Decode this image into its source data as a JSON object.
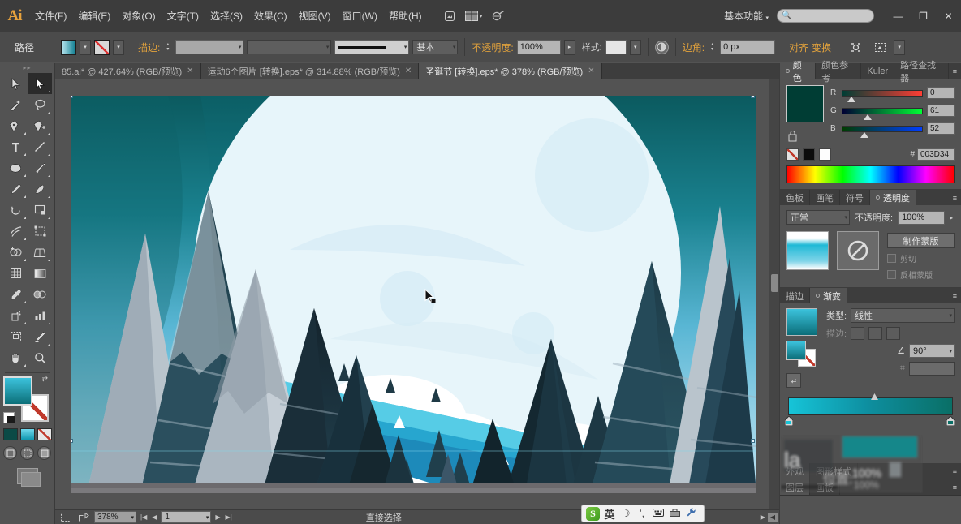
{
  "app": {
    "name": "Adobe Illustrator",
    "logo_text": "Ai"
  },
  "menubar": {
    "items": [
      {
        "label": "文件(F)"
      },
      {
        "label": "编辑(E)"
      },
      {
        "label": "对象(O)"
      },
      {
        "label": "文字(T)"
      },
      {
        "label": "选择(S)"
      },
      {
        "label": "效果(C)"
      },
      {
        "label": "视图(V)"
      },
      {
        "label": "窗口(W)"
      },
      {
        "label": "帮助(H)"
      }
    ],
    "bridge_icon": "bridge-icon",
    "arrange_icon": "arrange-documents-icon",
    "arrange_caret": "▾",
    "stock_icon": "stock-icon",
    "workspace": "基本功能",
    "workspace_caret": "▾",
    "search_placeholder": "",
    "search_value": "",
    "search_icon": "search-icon",
    "window_minimize": "—",
    "window_restore": "❐",
    "window_close": "✕"
  },
  "controlbar": {
    "object_label": "路径",
    "fill_label": "fill-swatch",
    "stroke_label": "stroke-swatch",
    "stroke_weight_label": "描边:",
    "stroke_weight_value": "",
    "stroke_profile_value": "",
    "brush_label": "brush-definition",
    "brush_value": "",
    "stroke_style_value": "",
    "variable_width_label": "基本",
    "opacity_label": "不透明度:",
    "opacity_value": "100%",
    "style_label": "样式:",
    "style_value": "",
    "recolor_icon": "recolor-artwork-icon",
    "corner_label": "边角:",
    "corner_value": "0 px",
    "align_label": "对齐",
    "transform_label": "变换",
    "isolate_icon": "isolate-selected-icon",
    "mask_icon": "edit-clipping-mask-icon",
    "more_caret": "▾"
  },
  "tabs": [
    {
      "label": "85.ai* @ 427.64% (RGB/预览)",
      "close": "✕",
      "active": false
    },
    {
      "label": "运动6个图片 [转换].eps* @ 314.88% (RGB/预览)",
      "close": "✕",
      "active": false
    },
    {
      "label": "圣诞节 [转换].eps* @ 378% (RGB/预览)",
      "close": "✕",
      "active": true
    }
  ],
  "toolbar": {
    "grip": "▸▸",
    "tools": [
      {
        "name": "selection-tool",
        "icon": "arrow-solid"
      },
      {
        "name": "direct-selection-tool",
        "icon": "arrow-hollow",
        "active": true
      },
      {
        "name": "magic-wand-tool",
        "icon": "wand"
      },
      {
        "name": "lasso-tool",
        "icon": "lasso"
      },
      {
        "name": "pen-tool",
        "icon": "pen"
      },
      {
        "name": "add-anchor-point-tool",
        "icon": "pen-plus"
      },
      {
        "name": "type-tool",
        "icon": "type-T"
      },
      {
        "name": "line-segment-tool",
        "icon": "line"
      },
      {
        "name": "ellipse-tool",
        "icon": "ellipse"
      },
      {
        "name": "paintbrush-tool",
        "icon": "paintbrush"
      },
      {
        "name": "pencil-tool",
        "icon": "pencil"
      },
      {
        "name": "blob-brush-tool",
        "icon": "blob-brush"
      },
      {
        "name": "rotate-tool",
        "icon": "rotate"
      },
      {
        "name": "scale-tool",
        "icon": "scale"
      },
      {
        "name": "width-tool",
        "icon": "width"
      },
      {
        "name": "free-transform-tool",
        "icon": "free-transform"
      },
      {
        "name": "shape-builder-tool",
        "icon": "shape-builder"
      },
      {
        "name": "perspective-grid-tool",
        "icon": "perspective-grid"
      },
      {
        "name": "mesh-tool",
        "icon": "mesh"
      },
      {
        "name": "gradient-tool",
        "icon": "gradient"
      },
      {
        "name": "eyedropper-tool",
        "icon": "eyedropper"
      },
      {
        "name": "blend-tool",
        "icon": "blend"
      },
      {
        "name": "symbol-sprayer-tool",
        "icon": "symbol-sprayer"
      },
      {
        "name": "column-graph-tool",
        "icon": "bar-graph"
      },
      {
        "name": "artboard-tool",
        "icon": "artboard"
      },
      {
        "name": "slice-tool",
        "icon": "slice"
      },
      {
        "name": "hand-tool",
        "icon": "hand"
      },
      {
        "name": "zoom-tool",
        "icon": "magnifier"
      }
    ],
    "fill_name": "fill-color-gradient",
    "stroke_name": "stroke-color-none",
    "swap_icon": "swap-fill-stroke-icon",
    "default_icon": "default-fill-stroke-icon",
    "color_btn": "color-button",
    "gradient_btn": "gradient-button",
    "none_btn": "none-button",
    "draw_normal": "draw-normal-button",
    "draw_behind": "draw-behind-button",
    "draw_inside": "draw-inside-button",
    "screen_mode": "change-screen-mode-button"
  },
  "canvas": {
    "zoom_shown": "378%",
    "artwork_title": "christmas-night-forest-illustration",
    "cursor": "direct-selection-cursor"
  },
  "statusbar": {
    "artboard_icon": "artboard-navigation-icon",
    "share_icon": "share-on-behance-icon",
    "zoom_value": "378%",
    "zoom_caret": "▾",
    "first_page": "|◀",
    "prev_page": "◀",
    "page_value": "1",
    "page_caret": "▾",
    "next_page": "▶",
    "last_page": "▶|",
    "current_tool": "直接选择",
    "scroll_right": "▶",
    "scroll_left": "◀"
  },
  "panels": {
    "color": {
      "tabs": [
        {
          "label": "颜色",
          "active": true
        },
        {
          "label": "颜色参考",
          "active": false
        },
        {
          "label": "Kuler",
          "active": false
        },
        {
          "label": "路径查找器",
          "active": false
        }
      ],
      "menu_icon": "panel-menu-icon",
      "current_color": "#003D34",
      "lock_icon": "lock-icon",
      "channels": [
        {
          "label": "R",
          "value": "0"
        },
        {
          "label": "G",
          "value": "61"
        },
        {
          "label": "B",
          "value": "52"
        }
      ],
      "hex_label": "#",
      "hex_value": "003D34",
      "none_swatch": "none-swatch",
      "black_swatch": "black-swatch",
      "white_swatch": "white-swatch",
      "spectrum": "color-spectrum-ramp"
    },
    "transparency": {
      "tabs": [
        {
          "label": "色板",
          "active": false
        },
        {
          "label": "画笔",
          "active": false
        },
        {
          "label": "符号",
          "active": false
        },
        {
          "label": "透明度",
          "active": true
        }
      ],
      "menu_icon": "panel-menu-icon",
      "blend_mode": "正常",
      "blend_caret": "▾",
      "opacity_label": "不透明度:",
      "opacity_value": "100%",
      "opacity_caret": "▸",
      "thumb_name": "object-thumbnail",
      "mask_name": "mask-thumbnail",
      "mask_icon": "no-mask-icon",
      "make_mask_label": "制作蒙版",
      "clip_label": "剪切",
      "invert_label": "反相蒙版"
    },
    "gradient": {
      "tabs": [
        {
          "label": "描边",
          "active": false
        },
        {
          "label": "渐变",
          "active": true
        }
      ],
      "menu_icon": "panel-menu-icon",
      "preview_name": "gradient-preview",
      "type_label": "类型:",
      "type_value": "线性",
      "type_caret": "▾",
      "stroke_label": "描边:",
      "angle_label": "角度",
      "angle_value": "90°",
      "angle_caret": "▾",
      "aspect_label": "长宽比",
      "aspect_value": "",
      "reverse_icon": "reverse-gradient-icon",
      "gradient_stops": [
        {
          "position": 0,
          "color": "#16C4D8"
        },
        {
          "position": 100,
          "color": "#0A6F66"
        }
      ],
      "location_label": "位置:",
      "location_value": "100%",
      "opacity_label": "不透明度:",
      "opacity_value": "100%"
    },
    "appearance": {
      "tabs": [
        {
          "label": "外观",
          "active": true
        },
        {
          "label": "图形样式",
          "active": false
        }
      ],
      "menu_icon": "panel-menu-icon"
    },
    "layers": {
      "tabs": [
        {
          "label": "图层",
          "active": true
        },
        {
          "label": "画板",
          "active": false
        }
      ],
      "menu_icon": "panel-menu-icon"
    }
  },
  "ime": {
    "logo": "S",
    "mode_label": "英",
    "moon_icon": "moon-icon",
    "comma_icon": "punctuation-icon",
    "keyboard_icon": "soft-keyboard-icon",
    "toolbox_icon": "toolbox-icon",
    "wrench_icon": "settings-wrench-icon"
  },
  "colors": {
    "app_bg": "#535353",
    "panel_bg": "#3D3D3D",
    "accent_teal": "#16C4D8",
    "fill_color": "#003D34",
    "sky_light": "#BFE2F2",
    "sky_dark": "#0E5F66",
    "moon": "#E3F3FA"
  }
}
